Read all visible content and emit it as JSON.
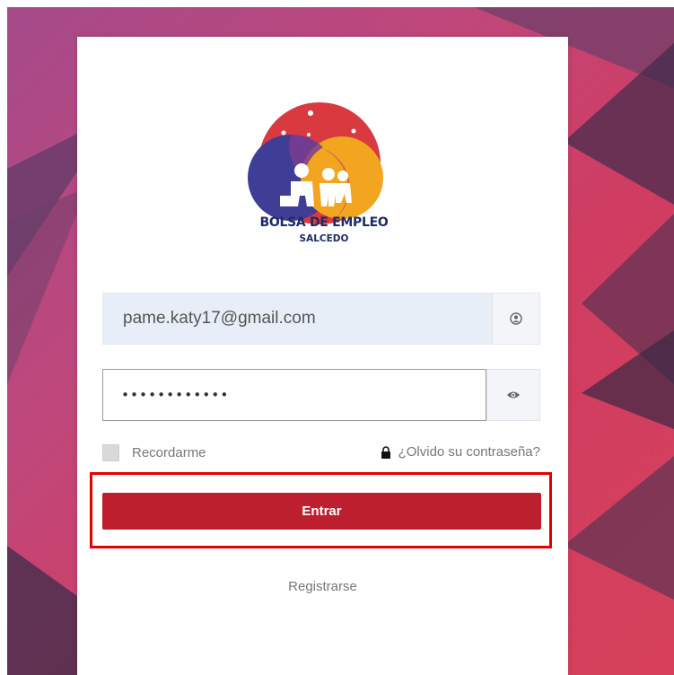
{
  "branding": {
    "title": "BOLSA DE EMPLEO",
    "subtitle": "SALCEDO"
  },
  "form": {
    "email_value": "pame.katy17@gmail.com",
    "password_value": "••••••••••••",
    "remember_label": "Recordarme",
    "forgot_label": "¿Olvido su contraseña?",
    "submit_label": "Entrar",
    "register_label": "Registrarse"
  },
  "icons": {
    "email_addon": "user-icon",
    "password_addon": "eye-icon",
    "forgot": "lock-icon"
  },
  "colors": {
    "primary_button": "#bd1f2f",
    "highlight_box": "#e50000",
    "background_accent": "#c0477a"
  }
}
